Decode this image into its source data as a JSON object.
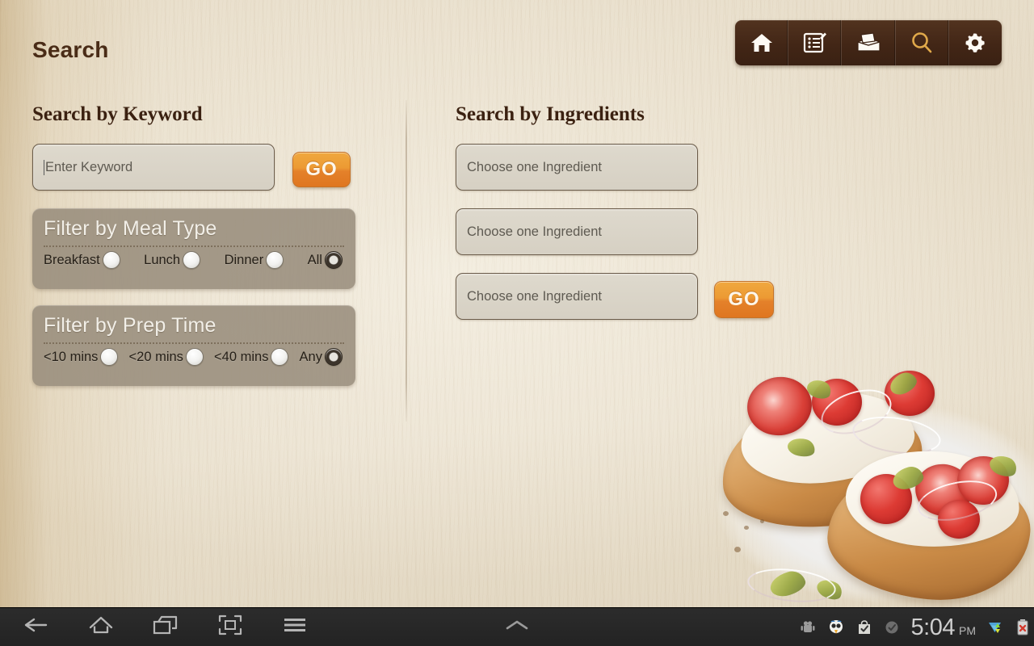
{
  "app": {
    "page_title": "Search"
  },
  "toolbar": {
    "items": [
      {
        "name": "home-icon",
        "label": "Home"
      },
      {
        "name": "recipes-icon",
        "label": "Recipes"
      },
      {
        "name": "recipe-box-icon",
        "label": "Recipe Box"
      },
      {
        "name": "search-icon",
        "label": "Search",
        "active": true,
        "color": "#e0a94a"
      },
      {
        "name": "settings-gear-icon",
        "label": "Settings"
      }
    ]
  },
  "keyword_panel": {
    "heading": "Search by Keyword",
    "input": {
      "value": "",
      "placeholder": "Enter Keyword"
    },
    "go_label": "GO",
    "meal_filter": {
      "title": "Filter by Meal Type",
      "options": [
        {
          "label": "Breakfast",
          "selected": false
        },
        {
          "label": "Lunch",
          "selected": false
        },
        {
          "label": "Dinner",
          "selected": false
        },
        {
          "label": "All",
          "selected": true
        }
      ]
    },
    "prep_filter": {
      "title": "Filter by Prep Time",
      "options": [
        {
          "label": "<10 mins",
          "selected": false
        },
        {
          "label": "<20 mins",
          "selected": false
        },
        {
          "label": "<40 mins",
          "selected": false
        },
        {
          "label": "Any",
          "selected": true
        }
      ]
    }
  },
  "ingredients_panel": {
    "heading": "Search by Ingredients",
    "fields": [
      {
        "value": "",
        "placeholder": "Choose one Ingredient"
      },
      {
        "value": "",
        "placeholder": "Choose one Ingredient"
      },
      {
        "value": "",
        "placeholder": "Choose one Ingredient"
      }
    ],
    "go_label": "GO"
  },
  "navbar": {
    "buttons": [
      {
        "name": "back-button"
      },
      {
        "name": "home-button"
      },
      {
        "name": "recent-apps-button"
      },
      {
        "name": "screenshot-button"
      },
      {
        "name": "menu-button"
      },
      {
        "name": "expand-notifications-button"
      }
    ],
    "status": {
      "icons": [
        {
          "name": "android-debug-icon"
        },
        {
          "name": "twitter-notification-icon"
        },
        {
          "name": "play-store-icon"
        },
        {
          "name": "sync-check-icon"
        }
      ],
      "time": "5:04",
      "ampm": "PM",
      "wifi_icon": "wifi-signal-icon",
      "battery_icon": "battery-error-icon"
    }
  },
  "colors": {
    "accent_orange": "#e4812a",
    "toolbar_brown": "#422616",
    "title_brown": "#4a2c17",
    "panel_gray": "#988d7c"
  }
}
